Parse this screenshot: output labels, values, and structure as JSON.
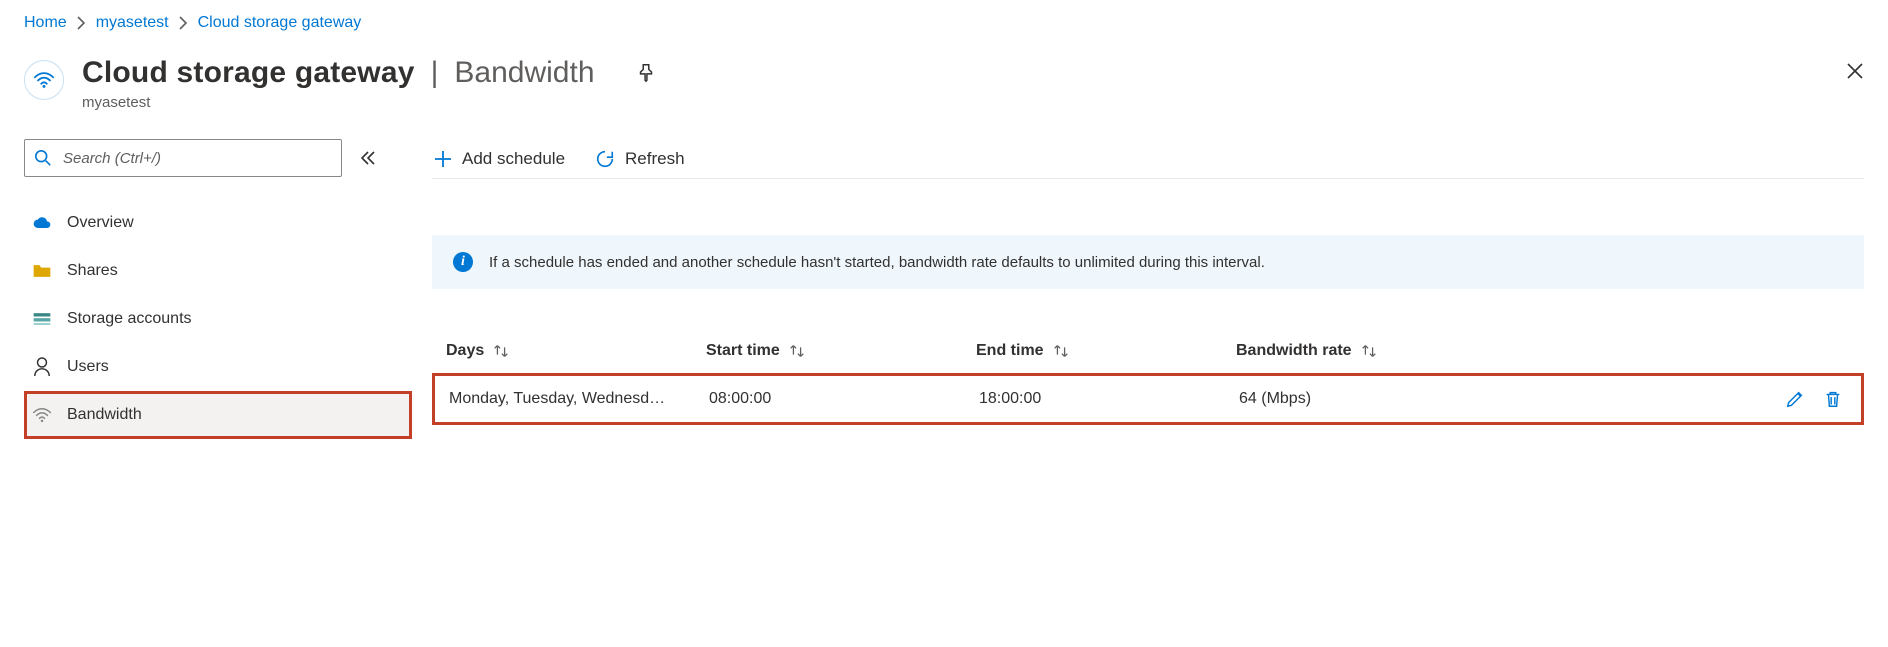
{
  "breadcrumb": [
    {
      "label": "Home"
    },
    {
      "label": "myasetest"
    },
    {
      "label": "Cloud storage gateway"
    }
  ],
  "header": {
    "title": "Cloud storage gateway",
    "section": "Bandwidth",
    "resource": "myasetest",
    "icon": "wifi-icon"
  },
  "sidebar": {
    "search_placeholder": "Search (Ctrl+/)",
    "items": [
      {
        "label": "Overview",
        "icon": "cloud-icon",
        "selected": false
      },
      {
        "label": "Shares",
        "icon": "folder-icon",
        "selected": false
      },
      {
        "label": "Storage accounts",
        "icon": "storage-icon",
        "selected": false
      },
      {
        "label": "Users",
        "icon": "person-icon",
        "selected": false
      },
      {
        "label": "Bandwidth",
        "icon": "wifi-icon",
        "selected": true
      }
    ]
  },
  "toolbar": {
    "add_label": "Add schedule",
    "refresh_label": "Refresh"
  },
  "banner": {
    "text": "If a schedule has ended and another schedule hasn't started, bandwidth rate defaults to unlimited during this interval."
  },
  "table": {
    "columns": {
      "days": "Days",
      "start": "Start time",
      "end": "End time",
      "rate": "Bandwidth rate"
    },
    "rows": [
      {
        "days": "Monday, Tuesday, Wednesd…",
        "start": "08:00:00",
        "end": "18:00:00",
        "rate": "64 (Mbps)"
      }
    ]
  }
}
